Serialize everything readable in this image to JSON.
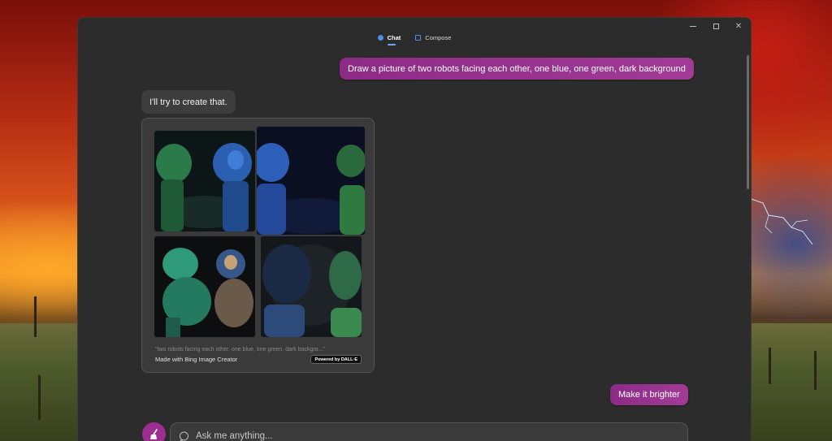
{
  "tabs": [
    {
      "label": "Chat",
      "icon": "chat-icon",
      "active": true
    },
    {
      "label": "Compose",
      "icon": "compose-icon",
      "active": false
    }
  ],
  "window_controls": [
    "minimize-icon",
    "maximize-icon",
    "close-icon"
  ],
  "messages": {
    "user_1": "Draw a picture of two robots facing each other, one blue, one green, dark background",
    "bot_1": "I'll try to create that.",
    "user_2": "Make it brighter"
  },
  "image_card": {
    "prompt_caption": "\"two robots facing each other, one blue, one green, dark backgro...\"",
    "made_with": "Made with Bing Image Creator",
    "badge": "Powered by DALL·E"
  },
  "composer": {
    "placeholder": "Ask me anything...",
    "value": ""
  },
  "colors": {
    "accent": "#9b2e90",
    "user_bubble": "#a23b96",
    "window_bg": "#2c2c2c",
    "tab_indicator": "#6ea6f0"
  }
}
